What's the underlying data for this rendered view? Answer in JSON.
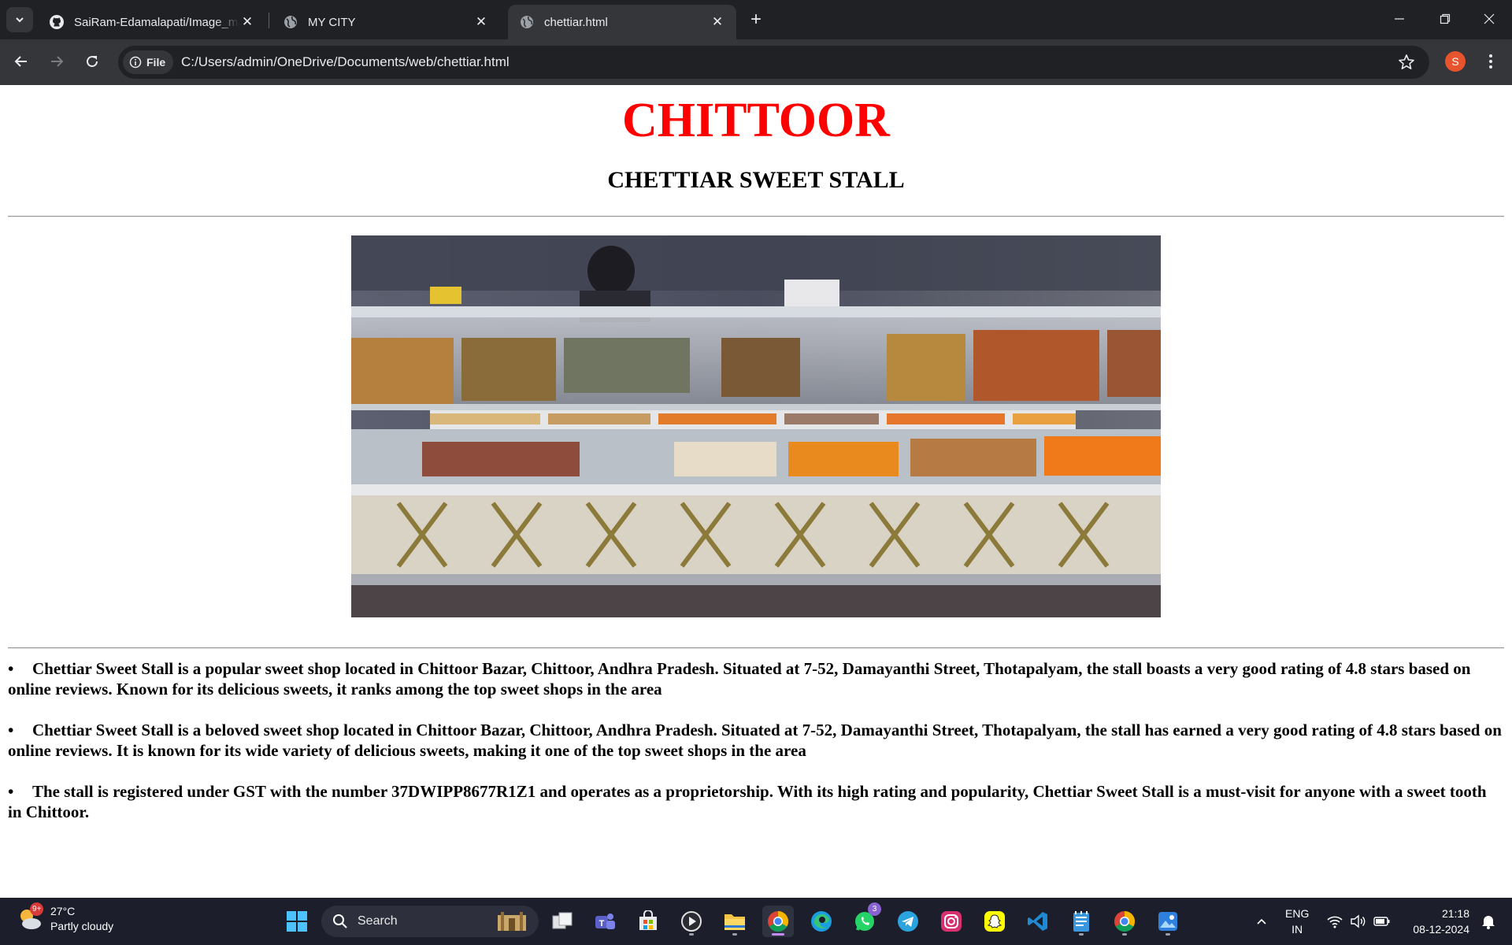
{
  "browser": {
    "tabs": [
      {
        "title": "SaiRam-Edamalapati/Image_ma",
        "favicon": "github-icon",
        "active": false
      },
      {
        "title": "MY CITY",
        "favicon": "globe-icon",
        "active": false
      },
      {
        "title": "chettiar.html",
        "favicon": "globe-icon",
        "active": true
      }
    ],
    "chip_label": "File",
    "url": "C:/Users/admin/OneDrive/Documents/web/chettiar.html",
    "profile_initial": "S"
  },
  "page": {
    "city": "CHITTOOR",
    "stall_name": "CHETTIAR SWEET STALL",
    "bullets": [
      "Chettiar Sweet Stall is a popular sweet shop located in Chittoor Bazar, Chittoor, Andhra Pradesh. Situated at 7-52, Damayanthi Street, Thotapalyam, the stall boasts a very good rating of 4.8 stars based on online reviews. Known for its delicious sweets, it ranks among the top sweet shops in the area",
      "Chettiar Sweet Stall is a beloved sweet shop located in Chittoor Bazar, Chittoor, Andhra Pradesh. Situated at 7-52, Damayanthi Street, Thotapalyam, the stall has earned a very good rating of 4.8 stars based on online reviews. It is known for its wide variety of delicious sweets, making it one of the top sweet shops in the area",
      "The stall is registered under GST with the number 37DWIPP8677R1Z1 and operates as a proprietorship. With its high rating and popularity, Chettiar Sweet Stall is a must-visit for anyone with a sweet tooth in Chittoor."
    ],
    "title_color": "#ff0000"
  },
  "taskbar": {
    "weather_badge": "9+",
    "temperature": "27°C",
    "condition": "Partly cloudy",
    "search_placeholder": "Search",
    "whatsapp_badge": "3",
    "lang_line1": "ENG",
    "lang_line2": "IN",
    "time": "21:18",
    "date": "08-12-2024"
  }
}
